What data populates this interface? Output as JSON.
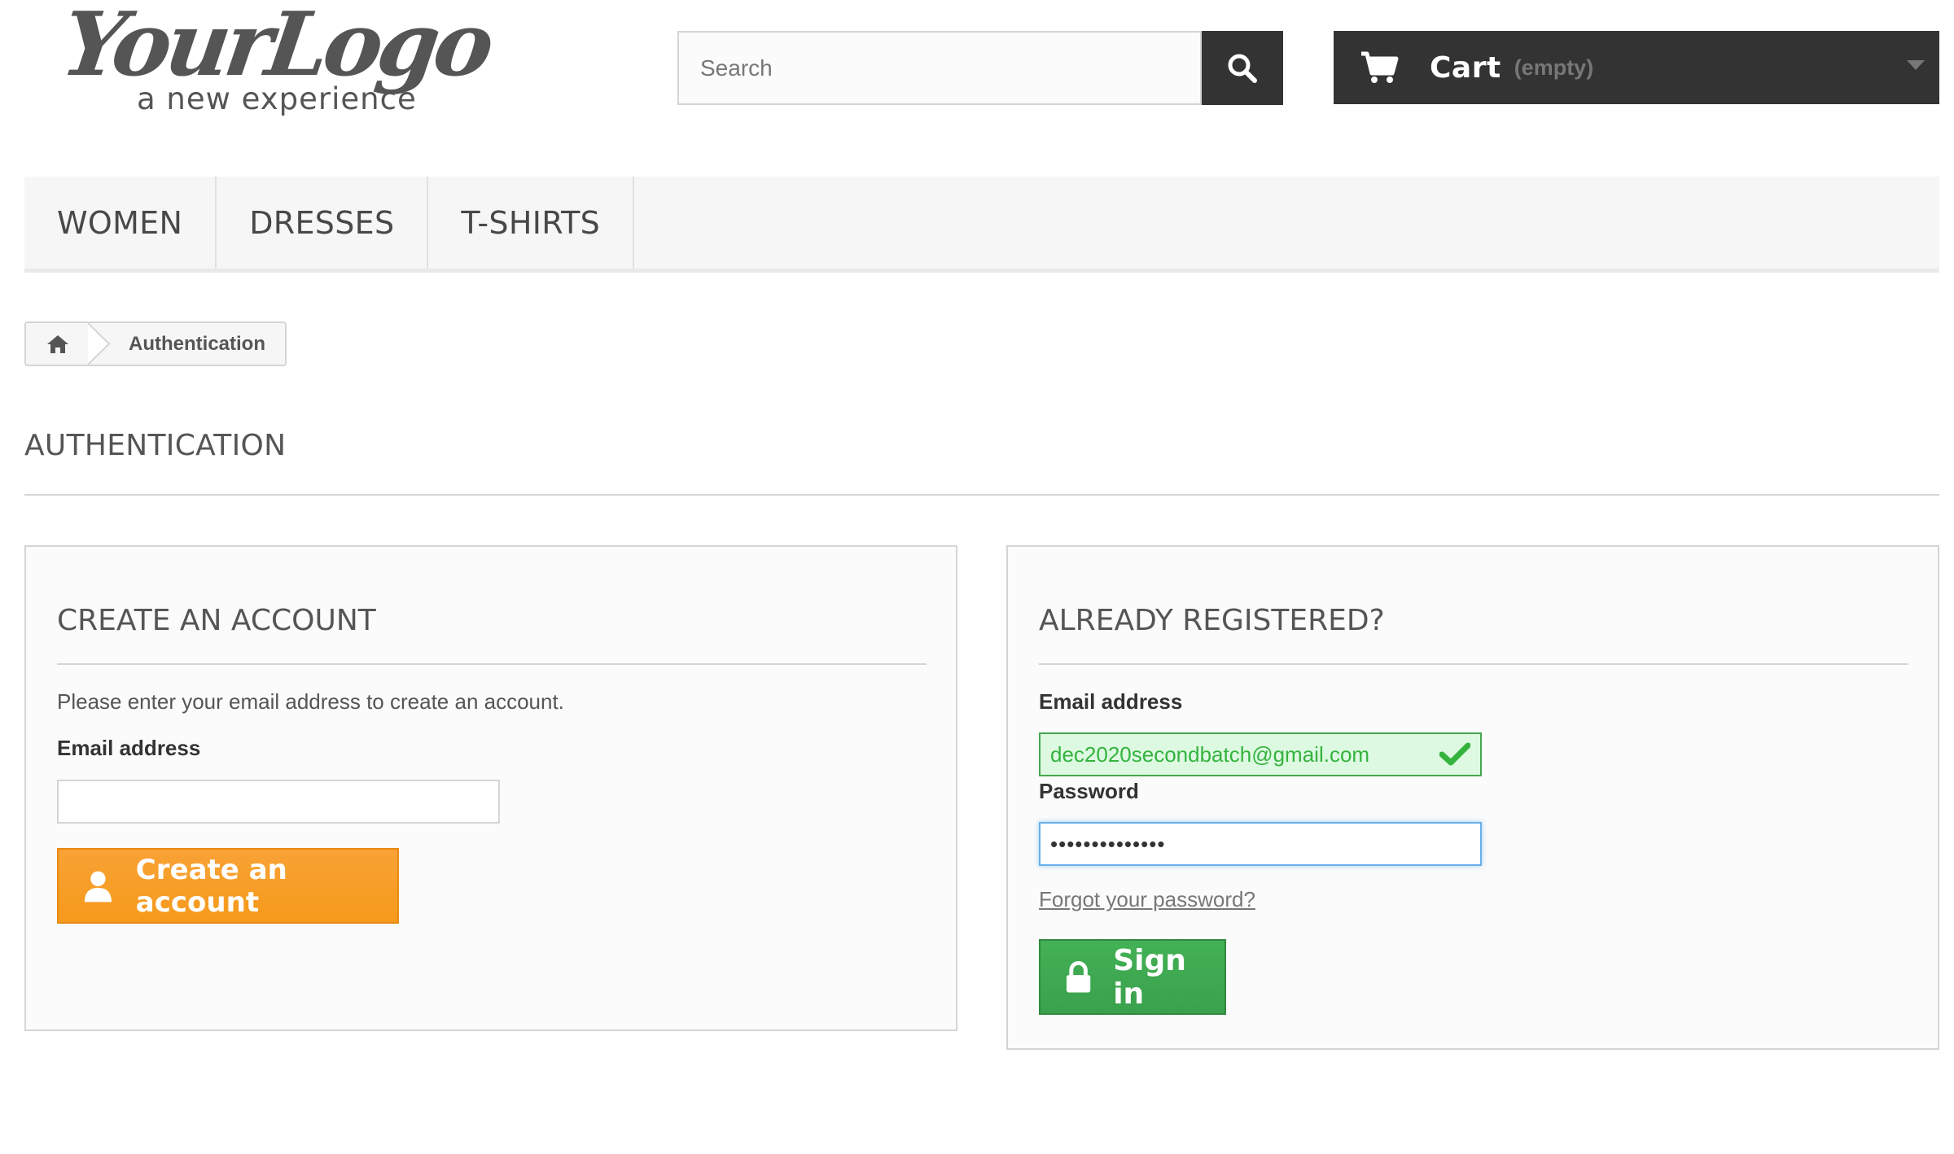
{
  "logo": {
    "main_text": "YourLogo",
    "tagline": "a new experience"
  },
  "search": {
    "placeholder": "Search",
    "icon": "search-icon"
  },
  "cart": {
    "label": "Cart",
    "status": "(empty)",
    "icon": "cart-icon"
  },
  "nav": {
    "items": [
      {
        "label": "WOMEN"
      },
      {
        "label": "DRESSES"
      },
      {
        "label": "T-SHIRTS"
      }
    ]
  },
  "breadcrumb": {
    "home_icon": "home-icon",
    "current": "Authentication"
  },
  "page": {
    "title": "AUTHENTICATION"
  },
  "create_account": {
    "title": "CREATE AN ACCOUNT",
    "instructions": "Please enter your email address to create an account.",
    "email_label": "Email address",
    "email_value": "",
    "button_label": "Create an account",
    "button_icon": "user-icon",
    "accent_color": "#f59a1b"
  },
  "sign_in": {
    "title": "ALREADY REGISTERED?",
    "email_label": "Email address",
    "email_value": "dec2020secondbatch@gmail.com",
    "email_status_icon": "check-icon",
    "password_label": "Password",
    "password_value": "••••••••••••••",
    "forgot_link": "Forgot your password?",
    "button_label": "Sign in",
    "button_icon": "lock-icon",
    "accent_color": "#3aa04c"
  }
}
